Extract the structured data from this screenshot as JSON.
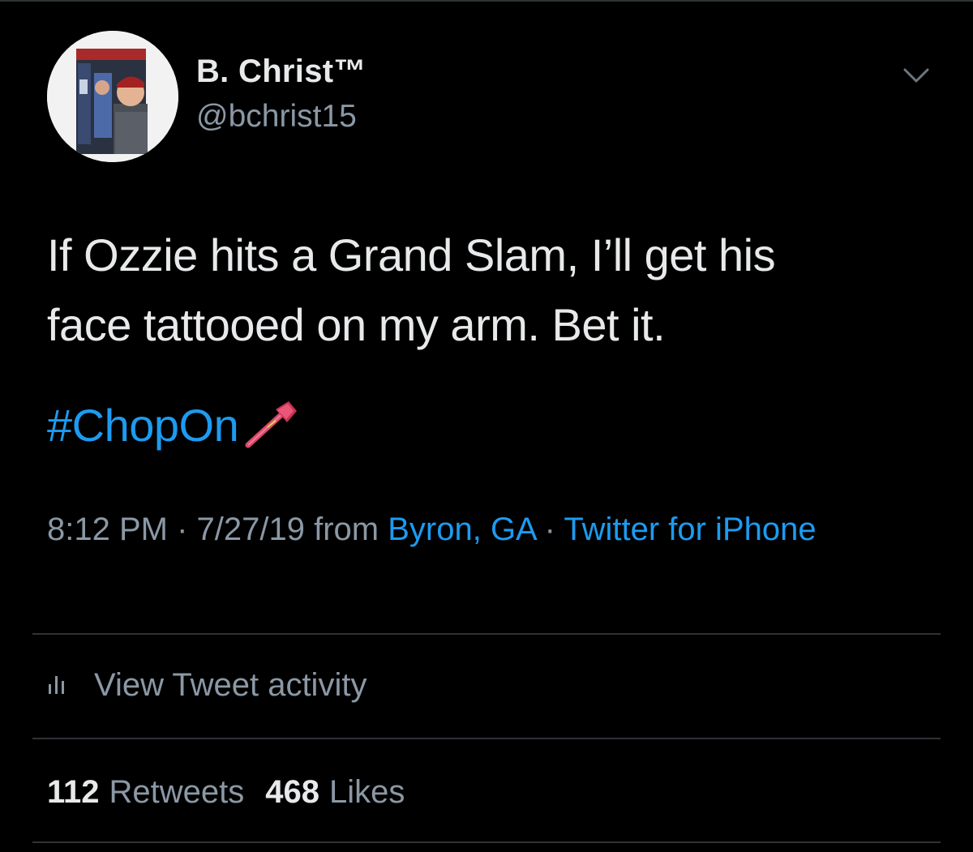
{
  "tweet": {
    "author": {
      "display_name": "B. Christ™",
      "handle": "@bchrist15",
      "avatar_icon": "profile-photo"
    },
    "menu_icon": "chevron-down-icon",
    "text": "If Ozzie hits a Grand Slam, I’ll get his\nface tattooed on my arm. Bet it.",
    "hashtag": "#ChopOn",
    "hashtag_emoji": "tomahawk-hashflag",
    "meta": {
      "time": "8:12 PM",
      "sep1": " · ",
      "date": "7/27/19",
      "from": " from ",
      "location": "Byron, GA",
      "sep2": " · ",
      "source": "Twitter for iPhone"
    },
    "activity": {
      "icon": "bar-chart-icon",
      "label": "View Tweet activity"
    },
    "stats": {
      "retweets_count": "112",
      "retweets_label": "Retweets",
      "likes_count": "468",
      "likes_label": "Likes"
    }
  },
  "colors": {
    "background": "#000000",
    "text_primary": "#e7e9ea",
    "text_secondary": "#8b98a5",
    "link": "#1d9bf0",
    "divider": "#2f3336"
  }
}
